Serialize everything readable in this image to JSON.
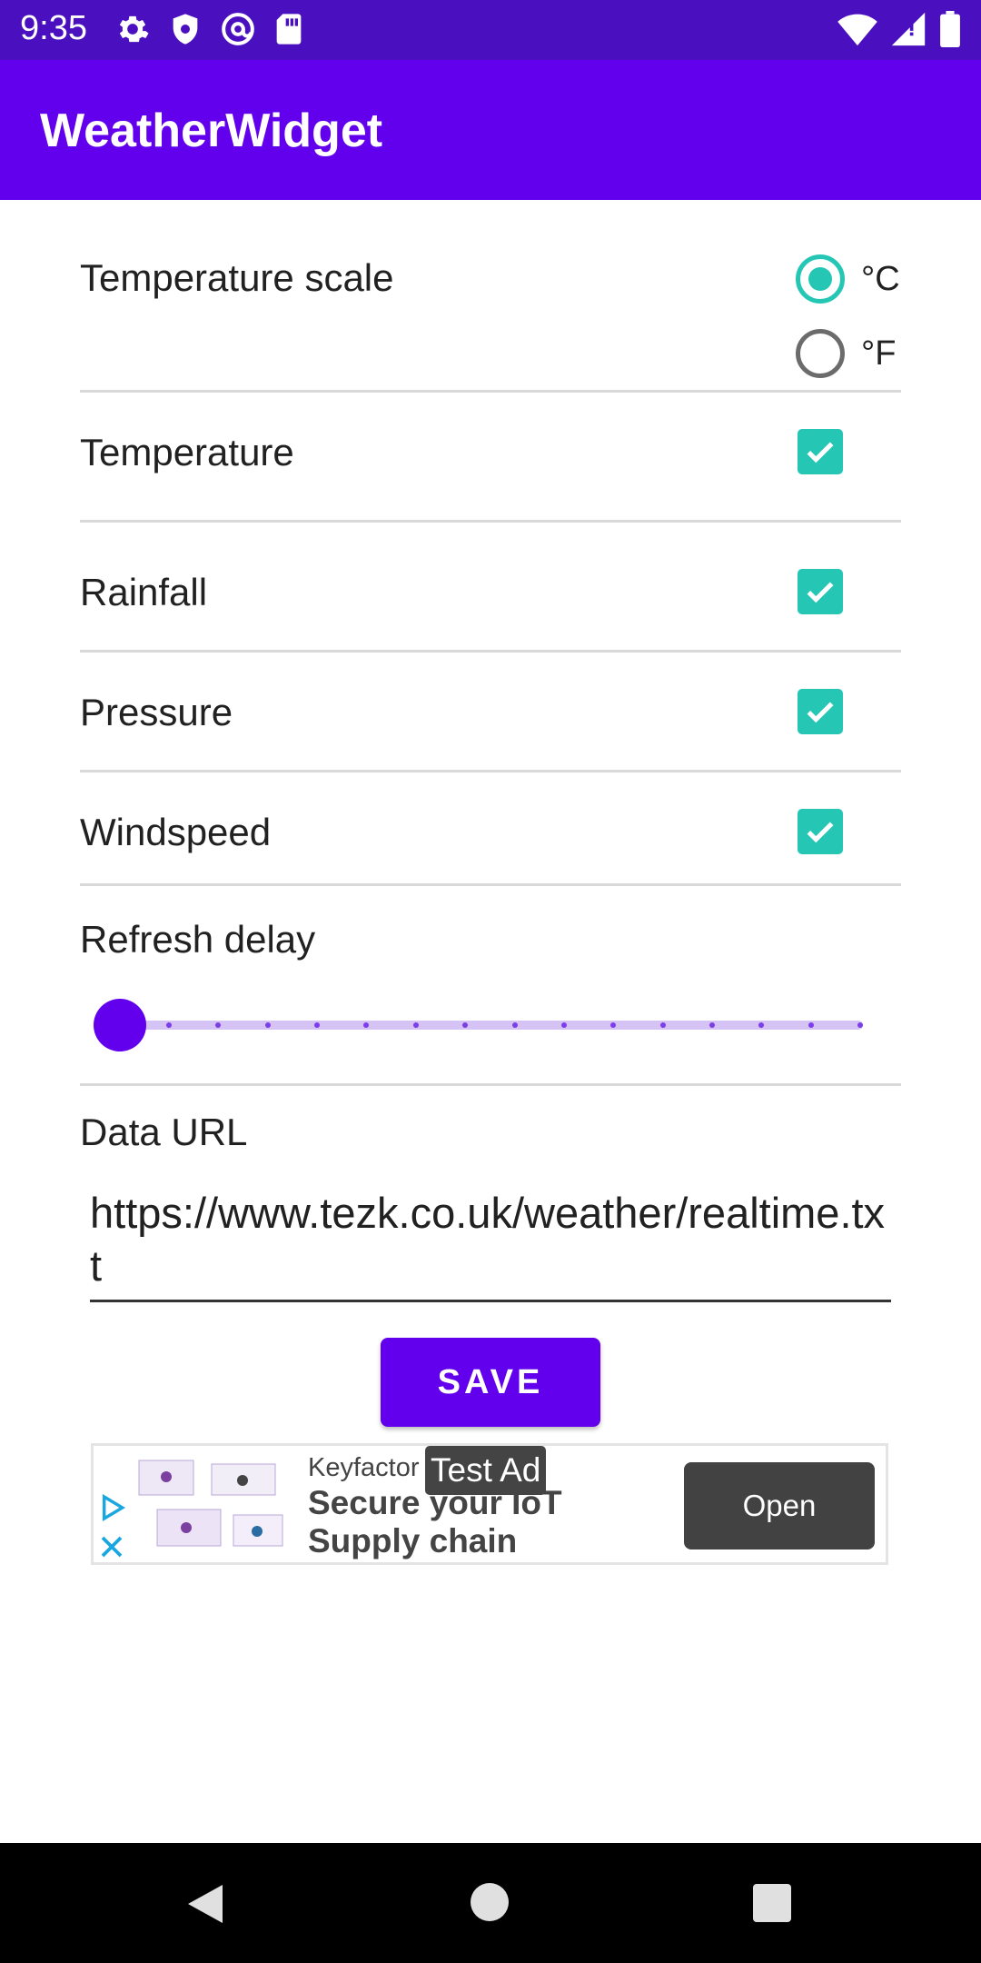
{
  "status_bar": {
    "time": "9:35",
    "left_icons": [
      "settings-icon",
      "shield-icon",
      "at-sign-icon",
      "sd-card-icon"
    ],
    "right_icons": [
      "wifi-icon",
      "signal-icon",
      "battery-icon"
    ]
  },
  "app_bar": {
    "title": "WeatherWidget"
  },
  "settings": {
    "temperature_scale": {
      "label": "Temperature scale",
      "options": [
        {
          "label": "°C",
          "selected": true
        },
        {
          "label": "°F",
          "selected": false
        }
      ]
    },
    "toggles": [
      {
        "label": "Temperature",
        "checked": true
      },
      {
        "label": "Rainfall",
        "checked": true
      },
      {
        "label": "Pressure",
        "checked": true
      },
      {
        "label": "Windspeed",
        "checked": true
      }
    ],
    "refresh_delay": {
      "label": "Refresh delay",
      "value_fraction": 0.0,
      "tick_count": 15
    },
    "data_url": {
      "label": "Data URL",
      "value": "https://www.tezk.co.uk/weather/realtime.txt"
    },
    "save_label": "SAVE"
  },
  "ad": {
    "advertiser": "Keyfactor",
    "headline": "Secure your IoT Supply chain",
    "test_label": "Test Ad",
    "cta": "Open"
  },
  "colors": {
    "status_bar": "#4a0fbf",
    "primary": "#6200ee",
    "accent": "#26c6b5"
  }
}
